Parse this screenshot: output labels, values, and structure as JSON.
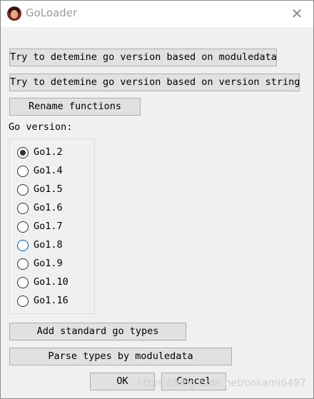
{
  "window": {
    "title": "GoLoader",
    "close_symbol": "✕"
  },
  "buttons": {
    "moduledata": "Try to detemine go version based on moduledata",
    "version_string": "Try to detemine go version based on version string",
    "rename": "Rename functions",
    "add_types": "Add standard go types",
    "parse_types": "Parse types by moduledata",
    "ok": "OK",
    "cancel": "Cancel"
  },
  "go_version": {
    "label": "Go version:",
    "selected": "Go1.2",
    "options": [
      "Go1.2",
      "Go1.4",
      "Go1.5",
      "Go1.6",
      "Go1.7",
      "Go1.8",
      "Go1.9",
      "Go1.10",
      "Go1.16"
    ]
  },
  "watermark": "https://blog.csdn.net/ookami6497",
  "icons": {
    "app": "avatar-app-icon",
    "close": "close-icon"
  }
}
